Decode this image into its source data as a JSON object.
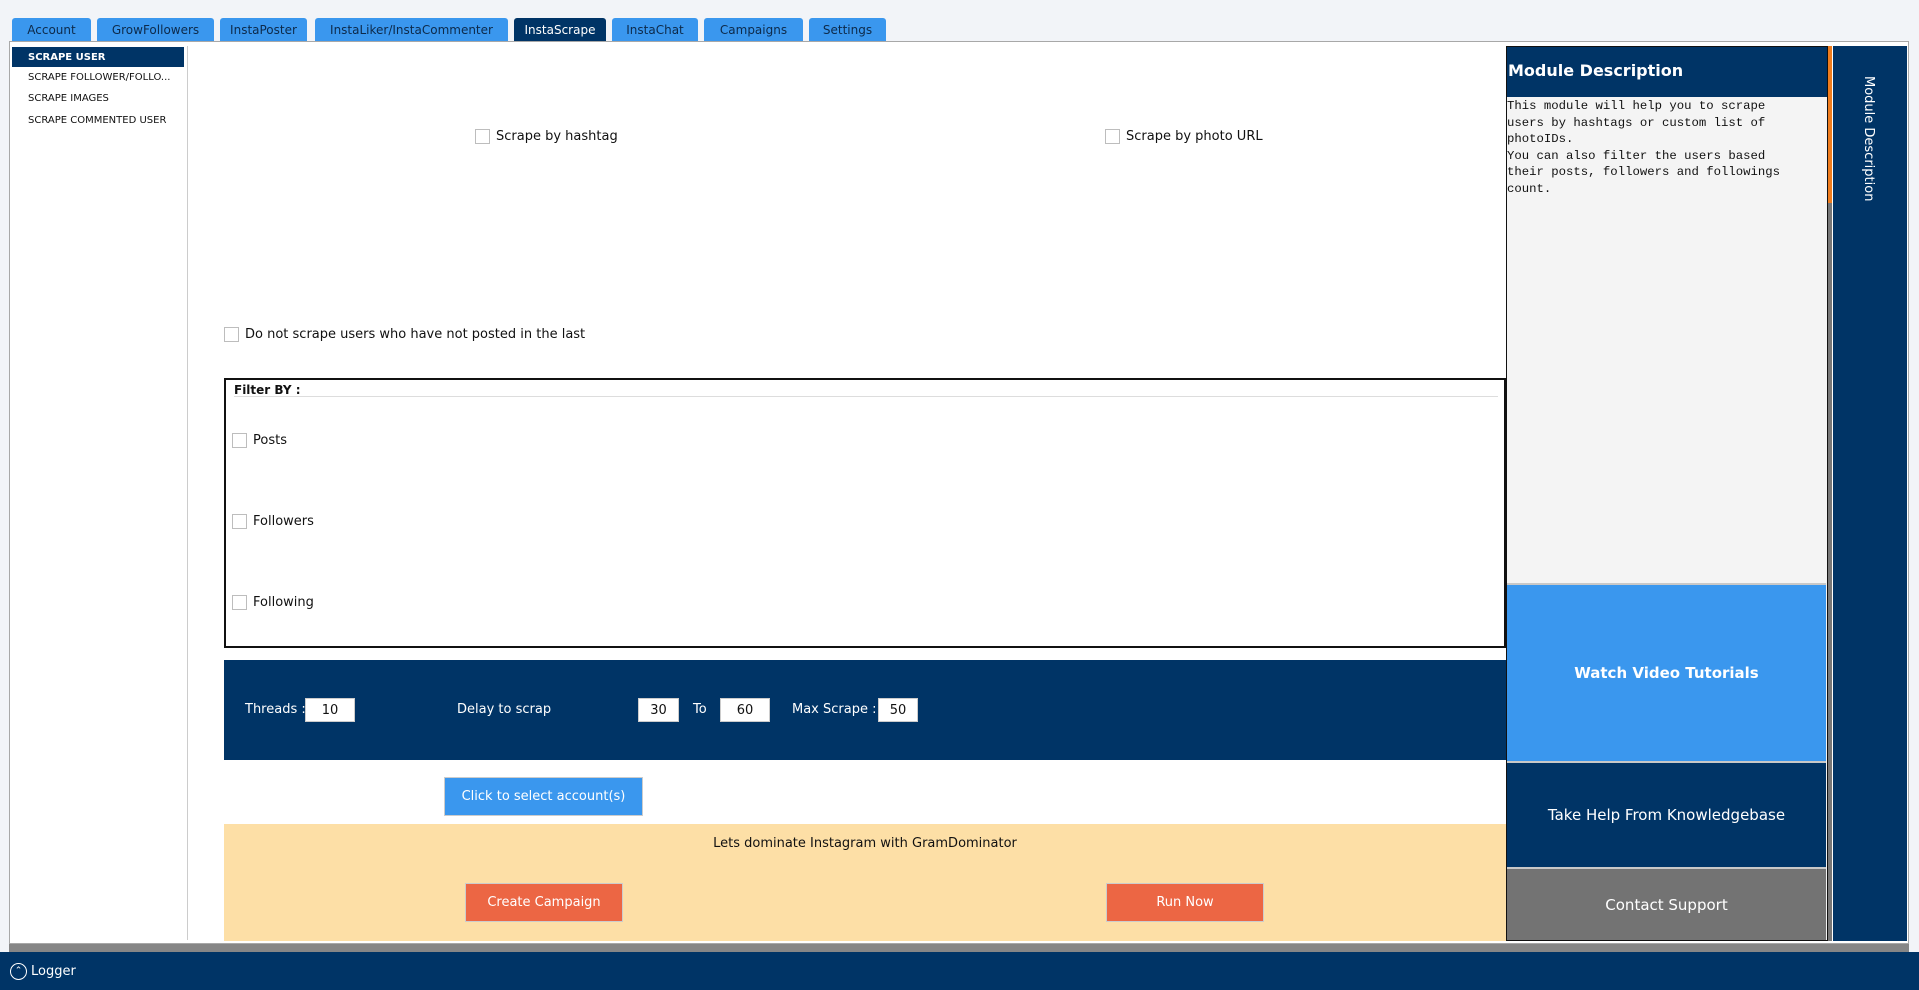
{
  "tabs": [
    {
      "label": "Account"
    },
    {
      "label": "GrowFollowers"
    },
    {
      "label": "InstaPoster"
    },
    {
      "label": "InstaLiker/InstaCommenter"
    },
    {
      "label": "InstaScrape",
      "active": true
    },
    {
      "label": "InstaChat"
    },
    {
      "label": "Campaigns"
    },
    {
      "label": "Settings"
    }
  ],
  "sidebar": {
    "items": [
      {
        "label": "SCRAPE USER",
        "active": true
      },
      {
        "label": "SCRAPE FOLLOWER/FOLLO..."
      },
      {
        "label": "SCRAPE IMAGES"
      },
      {
        "label": "SCRAPE COMMENTED USER"
      }
    ]
  },
  "options": {
    "by_hashtag": "Scrape by hashtag",
    "by_photo_url": "Scrape by  photo URL",
    "not_posted": "Do not scrape users who have not posted in the last"
  },
  "filter": {
    "title": "Filter BY :",
    "posts": "Posts",
    "followers": "Followers",
    "following": "Following"
  },
  "settings": {
    "threads_label": "Threads :",
    "threads": "10",
    "delay_label": "Delay to scrap",
    "delay_from": "30",
    "to_label": "To",
    "delay_to": "60",
    "max_label": "Max Scrape :",
    "max": "50"
  },
  "select_accounts": "Click to select account(s)",
  "promo": {
    "text": "Lets dominate Instagram with GramDominator",
    "create": "Create Campaign",
    "run": "Run Now"
  },
  "right": {
    "title": "Module Description",
    "description": "This module will help you to scrape\nusers by hashtags or custom list of\nphotoIDs.\nYou can also filter the users based\ntheir posts, followers and followings\ncount.",
    "video": "Watch Video Tutorials",
    "kb": "Take Help From Knowledgebase",
    "support": "Contact Support",
    "vertical_tab": "Module Description"
  },
  "logger": "Logger",
  "colors": {
    "navy": "#003466",
    "blue": "#3a97ee",
    "orange": "#ec6644",
    "promo_bg": "#fddfa6",
    "gray": "#737373"
  }
}
